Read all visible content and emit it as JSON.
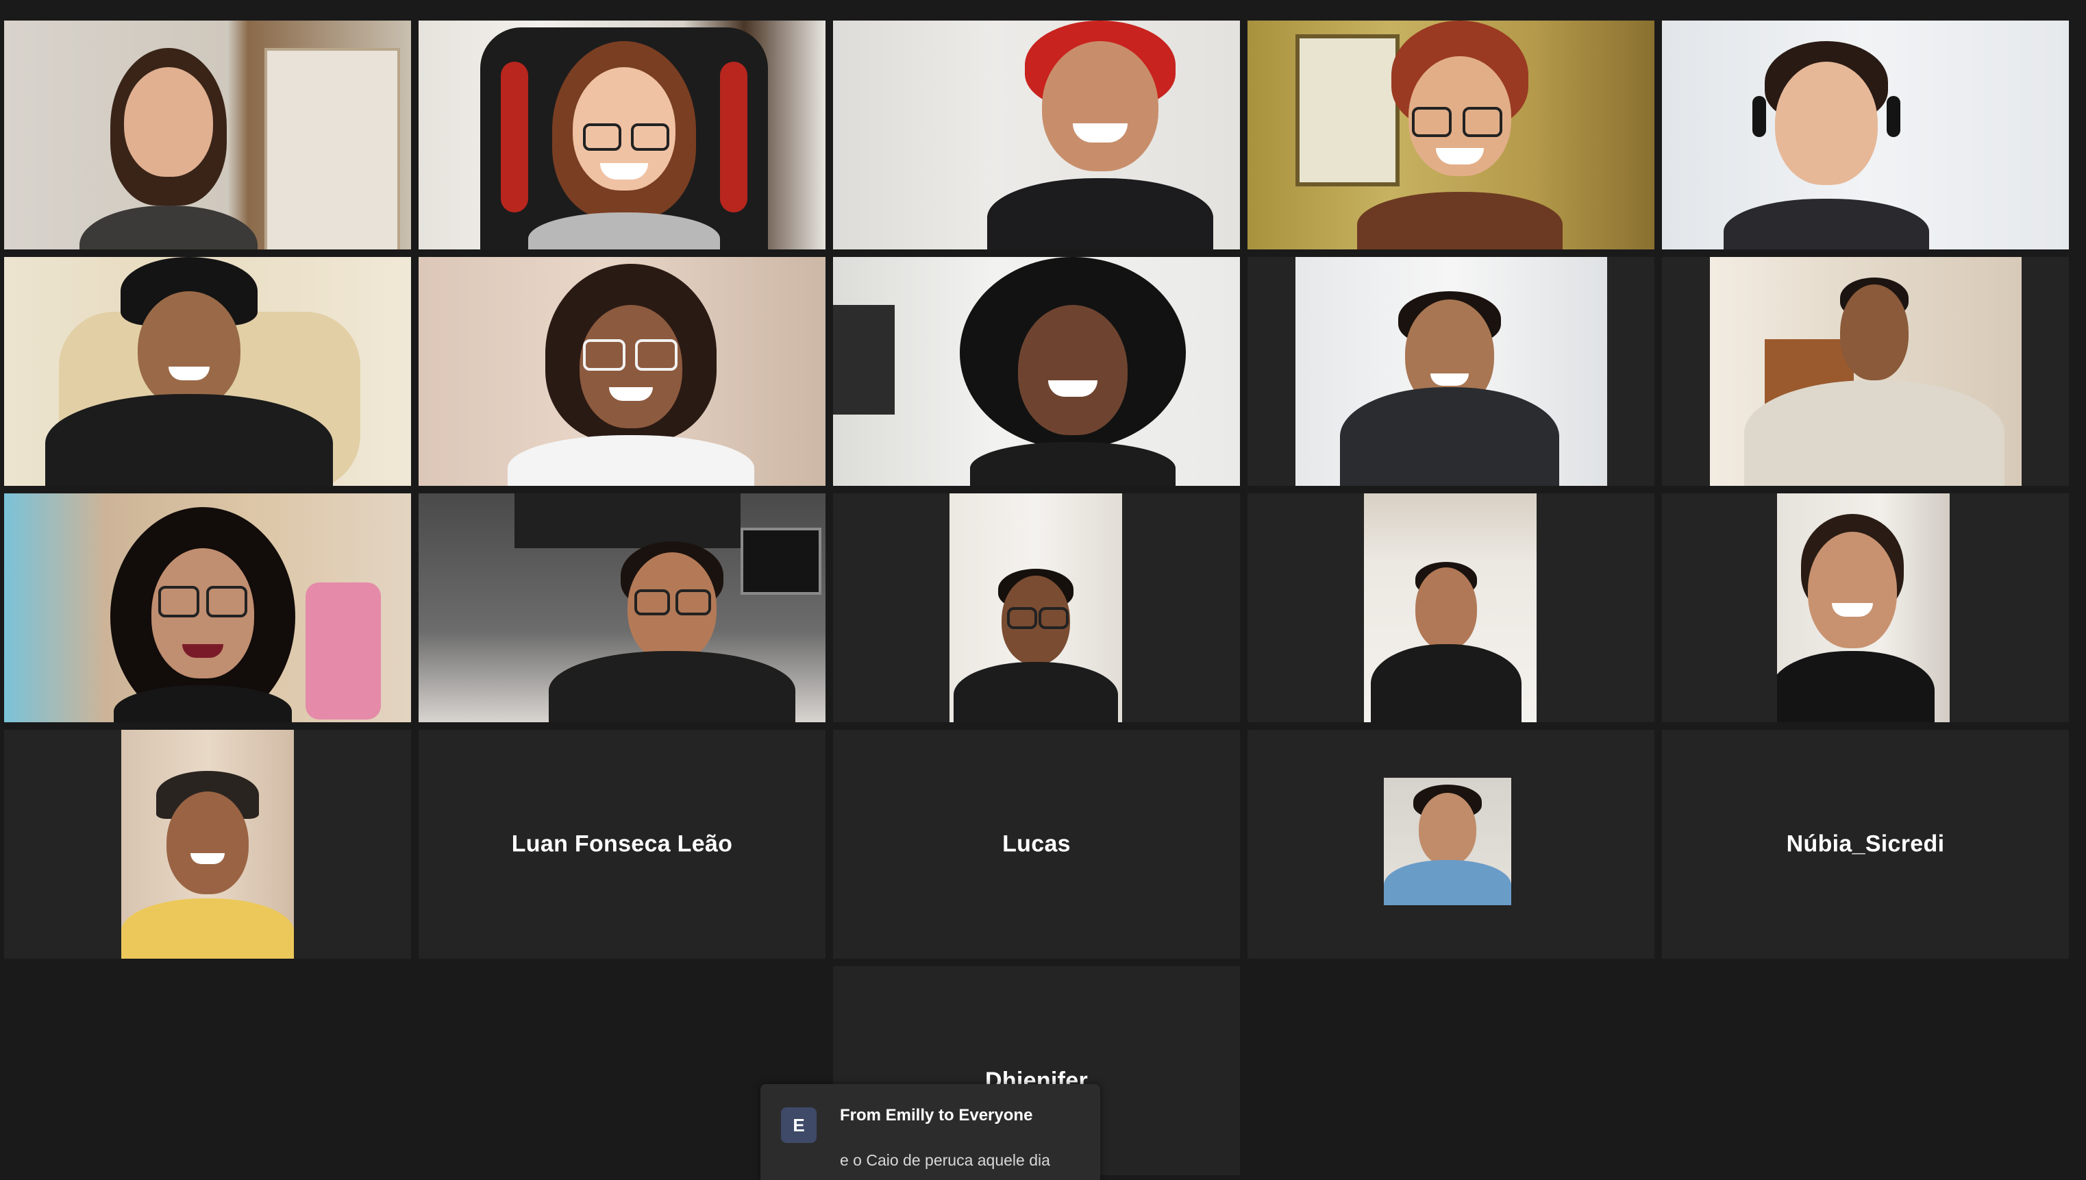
{
  "meeting": {
    "participants": [
      {
        "name": "",
        "tile": "video",
        "active_speaker": false
      },
      {
        "name": "",
        "tile": "video",
        "active_speaker": true
      },
      {
        "name": "",
        "tile": "video",
        "active_speaker": false
      },
      {
        "name": "",
        "tile": "video",
        "active_speaker": false
      },
      {
        "name": "",
        "tile": "video",
        "active_speaker": false
      },
      {
        "name": "",
        "tile": "video",
        "active_speaker": false
      },
      {
        "name": "",
        "tile": "video",
        "active_speaker": false
      },
      {
        "name": "",
        "tile": "video",
        "active_speaker": false
      },
      {
        "name": "",
        "tile": "video",
        "active_speaker": false
      },
      {
        "name": "",
        "tile": "video",
        "active_speaker": false
      },
      {
        "name": "",
        "tile": "video",
        "active_speaker": false
      },
      {
        "name": "",
        "tile": "video",
        "active_speaker": false
      },
      {
        "name": "",
        "tile": "video",
        "active_speaker": false
      },
      {
        "name": "",
        "tile": "video",
        "active_speaker": false
      },
      {
        "name": "",
        "tile": "video",
        "active_speaker": false
      },
      {
        "name": "",
        "tile": "video",
        "active_speaker": false
      },
      {
        "name": "Luan Fonseca Leão",
        "tile": "name",
        "active_speaker": false
      },
      {
        "name": "Lucas",
        "tile": "name",
        "active_speaker": false
      },
      {
        "name": "",
        "tile": "video",
        "active_speaker": false
      },
      {
        "name": "Núbia_Sicredi",
        "tile": "name",
        "active_speaker": false
      },
      {
        "name": "Dhienifer",
        "tile": "name",
        "active_speaker": false
      }
    ]
  },
  "chat_notification": {
    "avatar_initial": "E",
    "from": "From Emilly to Everyone",
    "message": "e o Caio de peruca aquele dia"
  },
  "colors": {
    "background": "#1a1a1a",
    "tile": "#242424",
    "active_speaker_border": "#d9d97a",
    "avatar": "#3e4a68"
  }
}
